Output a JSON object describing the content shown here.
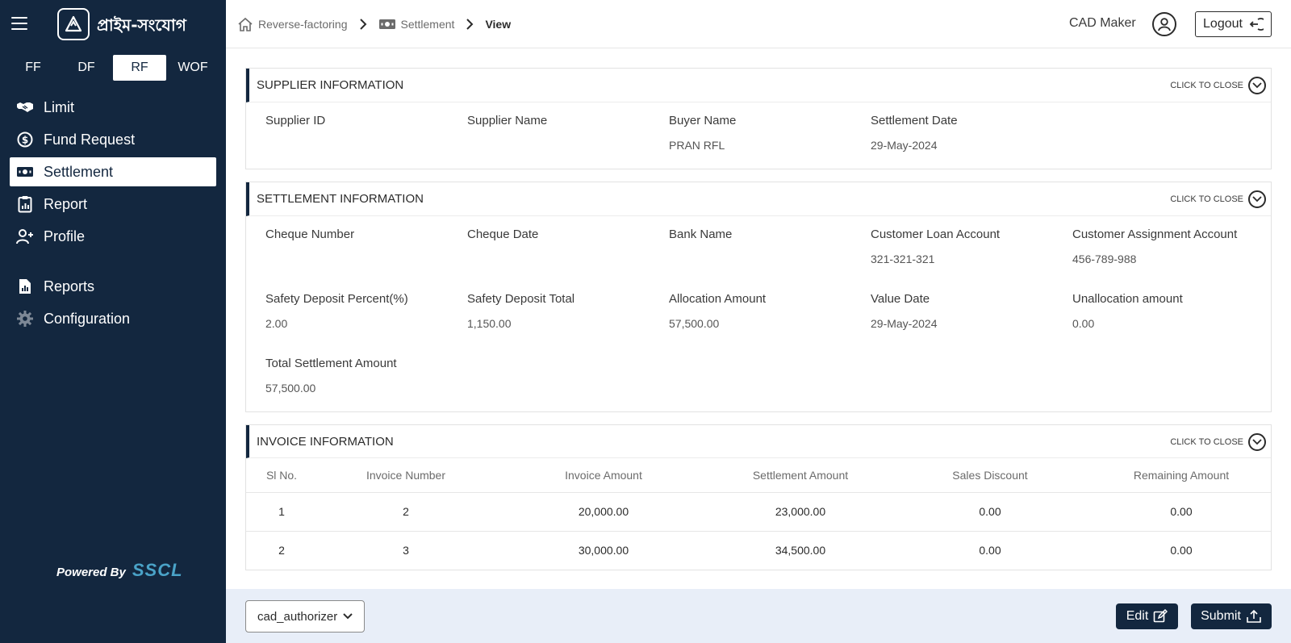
{
  "app": {
    "logo_text": "প্রাইম-সংযোগ",
    "powered_by_label": "Powered By",
    "powered_by_brand": "SSCL"
  },
  "module_tabs": [
    "FF",
    "DF",
    "RF",
    "WOF"
  ],
  "active_module": "RF",
  "nav": [
    {
      "label": "Limit",
      "icon": "handshake-icon"
    },
    {
      "label": "Fund Request",
      "icon": "dollar-circle-icon"
    },
    {
      "label": "Settlement",
      "icon": "banknote-icon",
      "active": true
    },
    {
      "label": "Report",
      "icon": "clipboard-chart-icon"
    },
    {
      "label": "Profile",
      "icon": "user-plus-icon"
    },
    {
      "label": "Reports",
      "icon": "file-chart-icon"
    },
    {
      "label": "Configuration",
      "icon": "gear-icon"
    }
  ],
  "breadcrumb": {
    "items": [
      "Reverse-factoring",
      "Settlement"
    ],
    "current": "View"
  },
  "header": {
    "user_name": "CAD Maker",
    "logout_label": "Logout"
  },
  "toggle_label": "CLICK TO CLOSE",
  "supplier": {
    "title": "SUPPLIER INFORMATION",
    "fields": [
      {
        "label": "Supplier ID",
        "value": ""
      },
      {
        "label": "Supplier Name",
        "value": ""
      },
      {
        "label": "Buyer Name",
        "value": "PRAN RFL"
      },
      {
        "label": "Settlement Date",
        "value": "29-May-2024"
      }
    ]
  },
  "settlement": {
    "title": "SETTLEMENT INFORMATION",
    "fields": [
      {
        "label": "Cheque Number",
        "value": ""
      },
      {
        "label": "Cheque Date",
        "value": ""
      },
      {
        "label": "Bank Name",
        "value": ""
      },
      {
        "label": "Customer Loan Account",
        "value": "321-321-321"
      },
      {
        "label": "Customer Assignment Account",
        "value": "456-789-988"
      },
      {
        "label": "Safety Deposit Percent(%)",
        "value": "2.00"
      },
      {
        "label": "Safety Deposit Total",
        "value": "1,150.00"
      },
      {
        "label": "Allocation Amount",
        "value": "57,500.00"
      },
      {
        "label": "Value Date",
        "value": "29-May-2024"
      },
      {
        "label": "Unallocation amount",
        "value": "0.00"
      },
      {
        "label": "Total Settlement Amount",
        "value": "57,500.00"
      }
    ]
  },
  "invoice": {
    "title": "INVOICE INFORMATION",
    "columns": [
      "Sl No.",
      "Invoice Number",
      "Invoice Amount",
      "Settlement Amount",
      "Sales Discount",
      "Remaining Amount"
    ],
    "rows": [
      [
        "1",
        "2",
        "20,000.00",
        "23,000.00",
        "0.00",
        "0.00"
      ],
      [
        "2",
        "3",
        "30,000.00",
        "34,500.00",
        "0.00",
        "0.00"
      ]
    ]
  },
  "footer": {
    "role_selected": "cad_authorizer",
    "edit_label": "Edit",
    "submit_label": "Submit"
  },
  "colors": {
    "sidebar_bg": "#13273f",
    "footer_bg": "#e8eef8",
    "brand_accent": "#4aa3c8"
  }
}
